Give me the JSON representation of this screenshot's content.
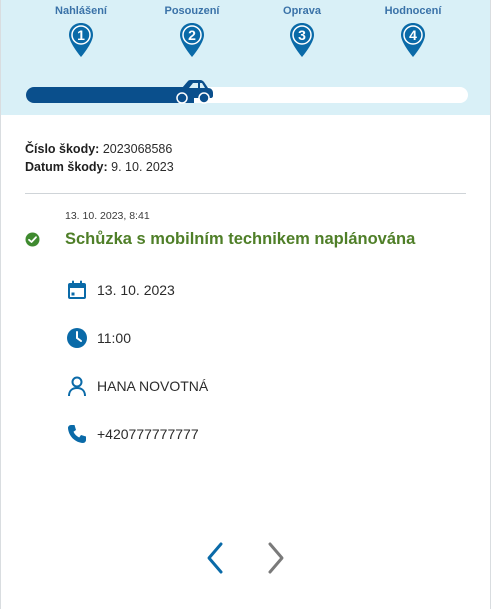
{
  "steps": [
    {
      "label": "Nahlášení",
      "number": "1"
    },
    {
      "label": "Posouzení",
      "number": "2"
    },
    {
      "label": "Oprava",
      "number": "3"
    },
    {
      "label": "Hodnocení",
      "number": "4"
    }
  ],
  "progress": {
    "fraction": 0.38,
    "fill_color": "#0a4f8c",
    "icon": "car-icon"
  },
  "claim": {
    "number_label": "Číslo škody:",
    "number_value": "2023068586",
    "date_label": "Datum škody:",
    "date_value": "9. 10. 2023"
  },
  "event": {
    "timestamp": "13. 10. 2023, 8:41",
    "status_icon": "check-circle-icon",
    "title": "Schůzka s mobilním technikem naplánována",
    "title_color": "#4f7f28",
    "details": {
      "date": {
        "icon": "calendar-icon",
        "text": "13. 10. 2023"
      },
      "time": {
        "icon": "clock-icon",
        "text": "11:00"
      },
      "person": {
        "icon": "person-icon",
        "text": "HANA NOVOTNÁ"
      },
      "phone": {
        "icon": "phone-icon",
        "text": "+420777777777"
      }
    }
  },
  "navigation": {
    "prev_icon": "chevron-left-icon",
    "next_icon": "chevron-right-icon",
    "prev_color": "#0a6aa8",
    "next_color": "#7a7a7a"
  },
  "colors": {
    "header_bg": "#d9f0f7",
    "accent_blue": "#0a6aa8",
    "pin_blue": "#0a6aa8"
  }
}
